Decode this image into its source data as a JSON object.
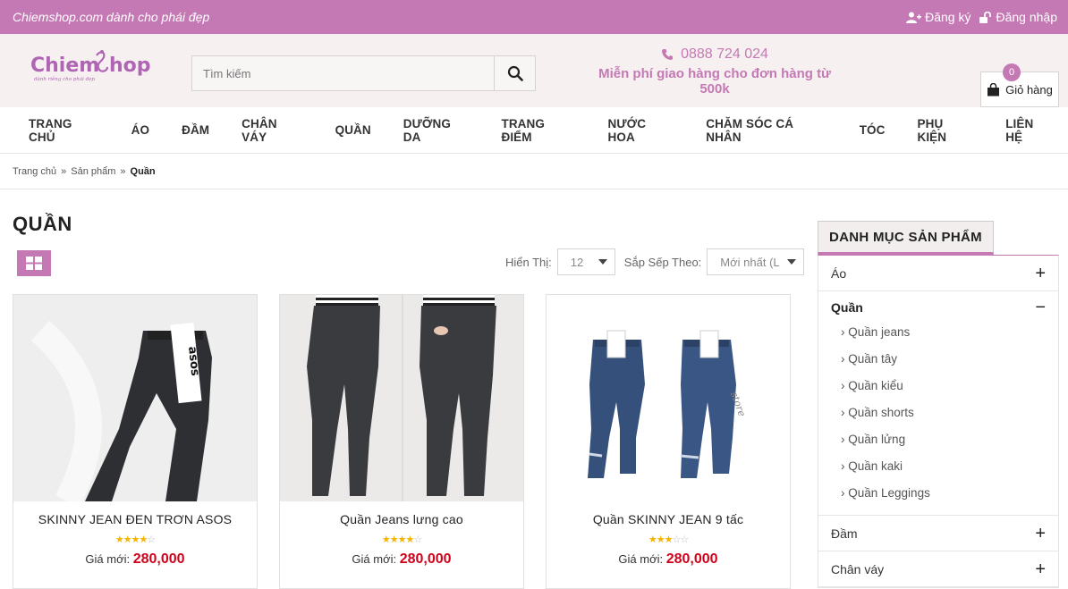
{
  "topbar": {
    "slogan": "Chiemshop.com dành cho phái đẹp",
    "register": "Đăng ký",
    "login": "Đăng nhập"
  },
  "logo": {
    "name": "ChiemShop",
    "tagline": "dành riêng cho phái đẹp"
  },
  "search": {
    "placeholder": "Tìm kiếm"
  },
  "hotline": {
    "phone": "0888 724 024",
    "shipping": "Miễn phí giao hàng cho đơn hàng từ 500k"
  },
  "cart": {
    "label": "Giỏ hàng",
    "count": "0"
  },
  "nav": [
    "TRANG CHỦ",
    "ÁO",
    "ĐẦM",
    "CHÂN VÁY",
    "QUẦN",
    "DƯỠNG DA",
    "TRANG ĐIỂM",
    "NƯỚC HOA",
    "CHĂM SÓC CÁ NHÂN",
    "TÓC",
    "PHỤ KIỆN",
    "LIÊN HỆ"
  ],
  "breadcrumb": {
    "home": "Trang chủ",
    "products": "Sản phẩm",
    "current": "Quần",
    "sep": "»"
  },
  "page": {
    "title": "QUẦN"
  },
  "toolbar": {
    "show_label": "Hiển Thị:",
    "show_value": "12",
    "sort_label": "Sắp Sếp Theo:",
    "sort_value": "Mới nhất (La"
  },
  "products": [
    {
      "name": "SKINNY JEAN ĐEN TRƠN ASOS",
      "rating": 4,
      "price_label": "Giá mới:",
      "price": "280,000"
    },
    {
      "name": "Quần Jeans lưng cao",
      "rating": 4,
      "price_label": "Giá mới:",
      "price": "280,000"
    },
    {
      "name": "Quần SKINNY JEAN 9 tấc",
      "rating": 3,
      "price_label": "Giá mới:",
      "price": "280,000"
    }
  ],
  "sidebar": {
    "title": "DANH MỤC SẢN PHẨM",
    "cat_ao": "Áo",
    "cat_quan": "Quần",
    "sub": [
      "Quần jeans",
      "Quần tây",
      "Quần kiểu",
      "Quần shorts",
      "Quần lửng",
      "Quần kaki",
      "Quần Leggings"
    ],
    "cat_dam": "Đầm",
    "cat_chanvay": "Chân váy"
  },
  "colors": {
    "brand": "#c579b4",
    "price": "#d0021b",
    "star": "#f4b400"
  }
}
